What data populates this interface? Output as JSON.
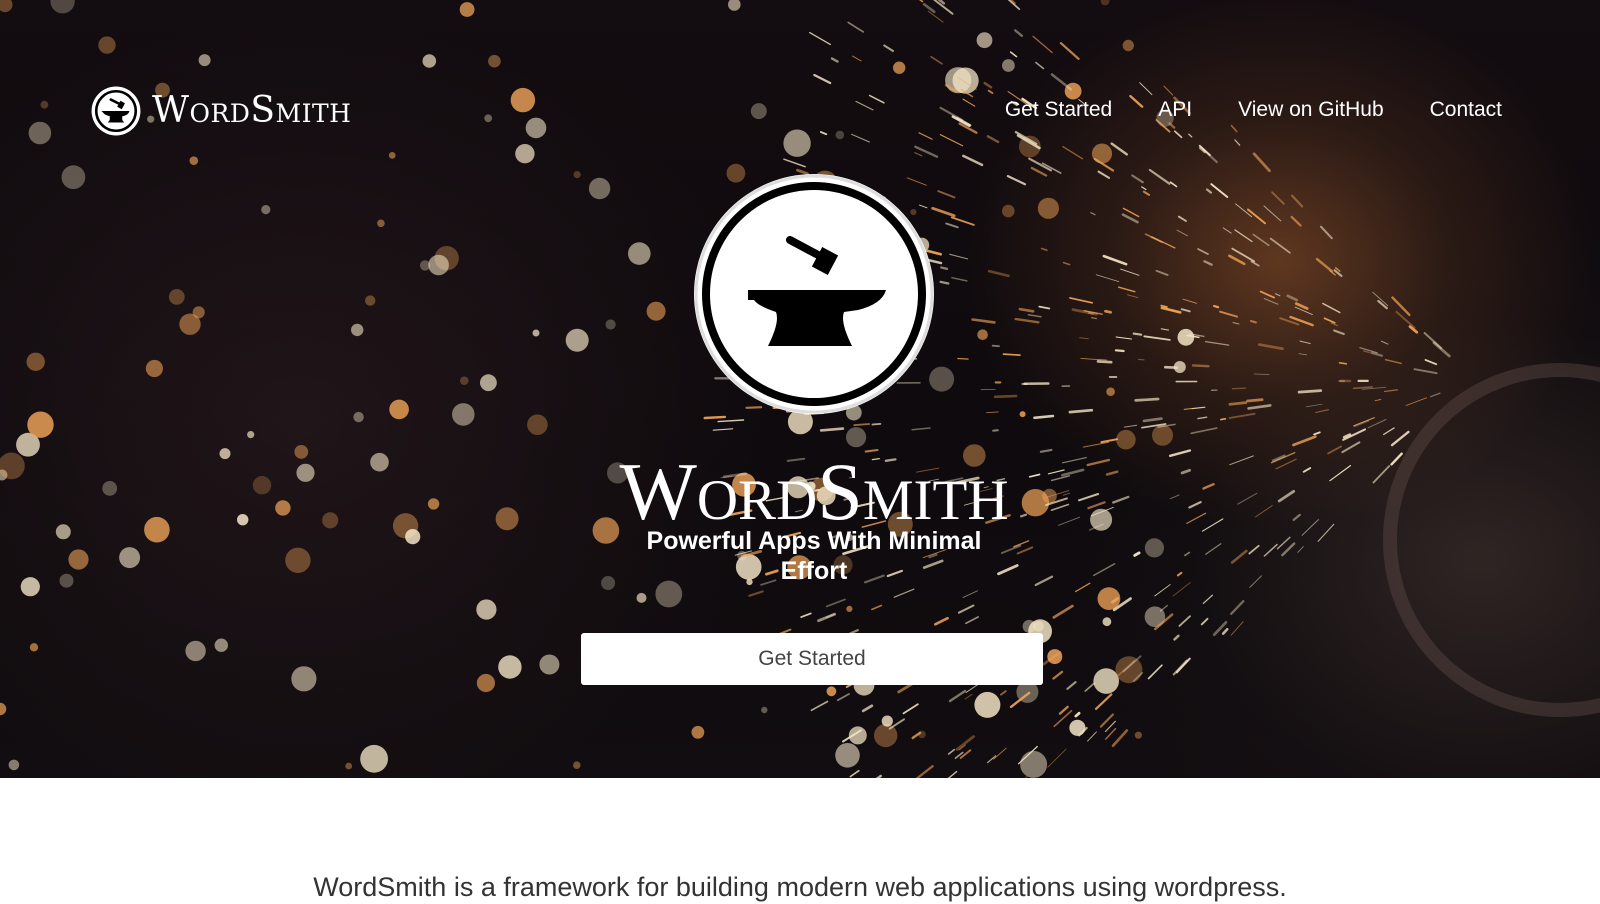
{
  "nav": {
    "brand": "WordSmith",
    "brand_icon": "anvil-icon",
    "links": [
      "Get Started",
      "API",
      "View on GitHub",
      "Contact"
    ]
  },
  "hero": {
    "icon": "anvil-icon",
    "title": "WordSmith",
    "tagline": "Powerful Apps With Minimal Effort",
    "cta_label": "Get Started"
  },
  "intro": {
    "text": "WordSmith is a framework for building modern web applications using wordpress."
  },
  "colors": {
    "hero_background": "#130c10",
    "spark_warm": "#f3a65a",
    "spark_light": "#f6e7c8",
    "text_on_dark": "#ffffff",
    "button_background": "#ffffff",
    "button_text": "#444444",
    "body_text": "#333333"
  }
}
